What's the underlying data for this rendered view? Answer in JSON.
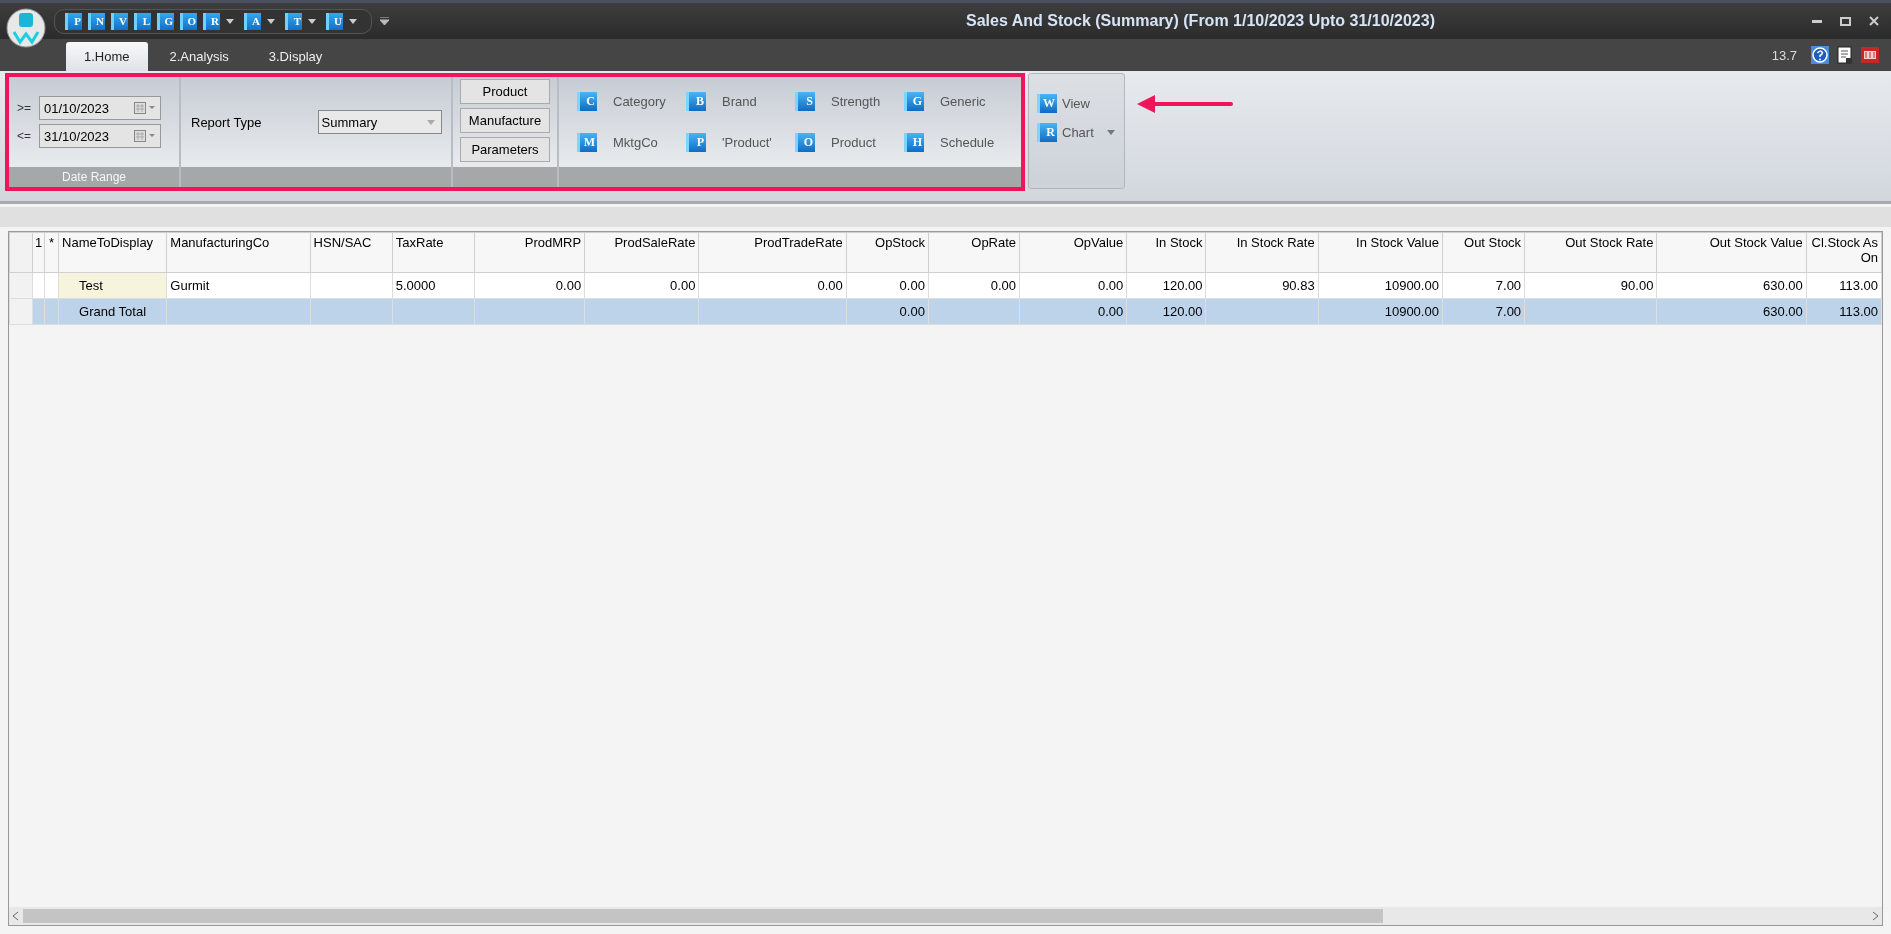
{
  "title_bar": {
    "title": "Sales And Stock (Summary)  (From 1/10/2023 Upto 31/10/2023)",
    "quick_access": [
      {
        "letter": "P",
        "has_menu": false
      },
      {
        "letter": "N",
        "has_menu": false
      },
      {
        "letter": "V",
        "has_menu": false
      },
      {
        "letter": "L",
        "has_menu": false
      },
      {
        "letter": "G",
        "has_menu": false
      },
      {
        "letter": "O",
        "has_menu": false
      },
      {
        "letter": "R",
        "has_menu": true
      },
      {
        "letter": "A",
        "has_menu": true
      },
      {
        "letter": "T",
        "has_menu": true
      },
      {
        "letter": "U",
        "has_menu": true
      }
    ]
  },
  "tabs": [
    {
      "label": "1.Home",
      "selected": true
    },
    {
      "label": "2.Analysis",
      "selected": false
    },
    {
      "label": "3.Display",
      "selected": false
    }
  ],
  "version": "13.7",
  "ribbon": {
    "date_range": {
      "caption": "Date Range",
      "rows": [
        {
          "operator": ">=",
          "value": "01/10/2023"
        },
        {
          "operator": "<=",
          "value": "31/10/2023"
        }
      ]
    },
    "report_type": {
      "label": "Report Type",
      "value": "Summary"
    },
    "filter_buttons": [
      "Product",
      "Manufacture",
      "Parameters"
    ],
    "groupings": [
      {
        "key": "C",
        "label": "Category"
      },
      {
        "key": "B",
        "label": "Brand"
      },
      {
        "key": "S",
        "label": "Strength"
      },
      {
        "key": "G",
        "label": "Generic"
      },
      {
        "key": "M",
        "label": "MktgCo"
      },
      {
        "key": "P",
        "label": "'Product'"
      },
      {
        "key": "O",
        "label": "Product"
      },
      {
        "key": "H",
        "label": "Schedule"
      }
    ],
    "actions": [
      {
        "key": "W",
        "label": "View",
        "has_menu": false
      },
      {
        "key": "R",
        "label": "Chart",
        "has_menu": true
      }
    ]
  },
  "table": {
    "columns": [
      {
        "label": "1",
        "kind": "index"
      },
      {
        "label": "*",
        "kind": "index"
      },
      {
        "label": "NameToDisplay",
        "kind": "name"
      },
      {
        "label": "ManufacturingCo",
        "kind": "text"
      },
      {
        "label": "HSN/SAC",
        "kind": "text"
      },
      {
        "label": "TaxRate",
        "kind": "text"
      },
      {
        "label": "ProdMRP",
        "kind": "number"
      },
      {
        "label": "ProdSaleRate",
        "kind": "number"
      },
      {
        "label": "ProdTradeRate",
        "kind": "number"
      },
      {
        "label": "OpStock",
        "kind": "number"
      },
      {
        "label": "OpRate",
        "kind": "number"
      },
      {
        "label": "OpValue",
        "kind": "number"
      },
      {
        "label": "In Stock",
        "kind": "number"
      },
      {
        "label": "In Stock Rate",
        "kind": "number"
      },
      {
        "label": "In Stock Value",
        "kind": "number"
      },
      {
        "label": "Out Stock",
        "kind": "number"
      },
      {
        "label": "Out Stock Rate",
        "kind": "number"
      },
      {
        "label": "Out Stock Value",
        "kind": "number"
      },
      {
        "label": "Cl.Stock As On",
        "kind": "number"
      }
    ],
    "rows": [
      {
        "kind": "data",
        "cells": [
          null,
          null,
          "Test",
          "Gurmit",
          null,
          "5.0000",
          "0.00",
          "0.00",
          "0.00",
          "0.00",
          "0.00",
          "0.00",
          "120.00",
          "90.83",
          "10900.00",
          "7.00",
          "90.00",
          "630.00",
          "113.00"
        ]
      },
      {
        "kind": "total",
        "cells": [
          null,
          null,
          "Grand Total",
          null,
          null,
          null,
          null,
          null,
          null,
          "0.00",
          null,
          "0.00",
          "120.00",
          null,
          "10900.00",
          "7.00",
          null,
          "630.00",
          "113.00"
        ]
      }
    ]
  }
}
